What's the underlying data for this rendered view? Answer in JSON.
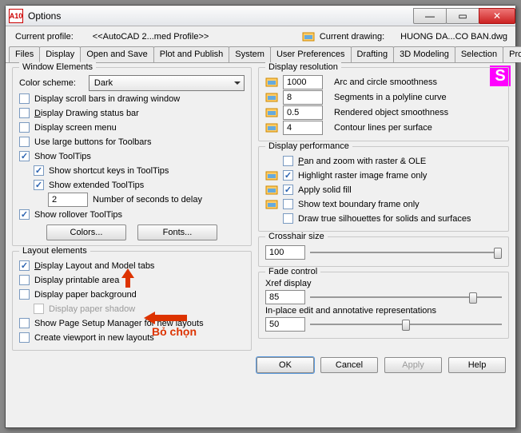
{
  "window": {
    "title": "Options",
    "app_icon_text": "A10"
  },
  "profile": {
    "label_profile": "Current profile:",
    "value_profile": "<<AutoCAD 2...med Profile>>",
    "label_drawing": "Current drawing:",
    "value_drawing": "HUONG DA...CO BAN.dwg"
  },
  "tabs": [
    "Files",
    "Display",
    "Open and Save",
    "Plot and Publish",
    "System",
    "User Preferences",
    "Drafting",
    "3D Modeling",
    "Selection",
    "Profiles"
  ],
  "active_tab_index": 1,
  "window_elements": {
    "title": "Window Elements",
    "color_scheme_label": "Color scheme:",
    "color_scheme_value": "Dark",
    "scroll_bars": "Display scroll bars in drawing window",
    "drawing_status": "Display Drawing status bar",
    "screen_menu": "Display screen menu",
    "large_buttons": "Use large buttons for Toolbars",
    "tooltips": "Show ToolTips",
    "shortcut_keys": "Show shortcut keys in ToolTips",
    "extended_tooltips": "Show extended ToolTips",
    "seconds_value": "2",
    "seconds_label": "Number of seconds to delay",
    "rollover": "Show rollover ToolTips",
    "colors_btn": "Colors...",
    "fonts_btn": "Fonts..."
  },
  "layout_elements": {
    "title": "Layout elements",
    "layout_model": "Display Layout and Model tabs",
    "printable": "Display printable area",
    "paper_bg": "Display paper background",
    "paper_shadow": "Display paper shadow",
    "page_setup": "Show Page Setup Manager for new layouts",
    "viewport": "Create viewport in new layouts"
  },
  "display_resolution": {
    "title": "Display resolution",
    "arc_value": "1000",
    "arc_label": "Arc and circle smoothness",
    "seg_value": "8",
    "seg_label": "Segments in a polyline curve",
    "rend_value": "0.5",
    "rend_label": "Rendered object smoothness",
    "cont_value": "4",
    "cont_label": "Contour lines per surface"
  },
  "display_performance": {
    "title": "Display performance",
    "pan_zoom": "Pan and zoom with raster & OLE",
    "highlight_raster": "Highlight raster image frame only",
    "solid_fill": "Apply solid fill",
    "text_boundary": "Show text boundary frame only",
    "true_silhouettes": "Draw true silhouettes for solids and surfaces"
  },
  "crosshair": {
    "title": "Crosshair size",
    "value": "100",
    "thumb_pct": 98
  },
  "fade": {
    "title": "Fade control",
    "xref_label": "Xref display",
    "xref_value": "85",
    "xref_pct": 85,
    "inplace_label": "In-place edit and annotative representations",
    "inplace_value": "50",
    "inplace_pct": 50
  },
  "footer": {
    "ok": "OK",
    "cancel": "Cancel",
    "apply": "Apply",
    "help": "Help"
  },
  "annotation": {
    "text": "Bỏ chọn"
  }
}
